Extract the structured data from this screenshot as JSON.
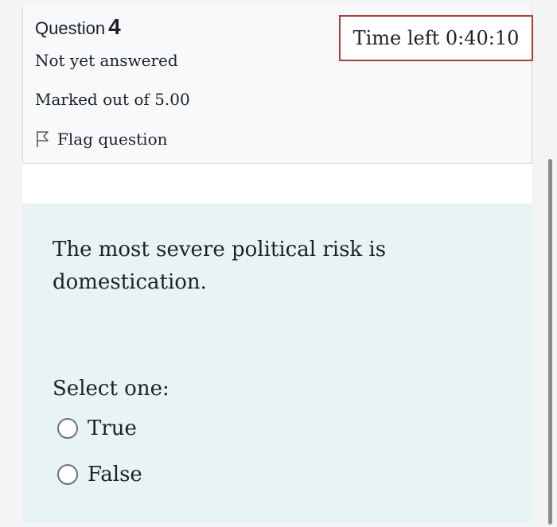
{
  "question_info": {
    "label": "Question",
    "number": "4",
    "status": "Not yet answered",
    "marked_out_of": "Marked out of 5.00",
    "flag_label": "Flag question"
  },
  "timer": {
    "text": "Time left 0:40:10"
  },
  "question": {
    "text": "The most severe political risk is domestication.",
    "prompt": "Select one:",
    "options": [
      {
        "label": "True"
      },
      {
        "label": "False"
      }
    ]
  },
  "icons": {
    "flag": "flag-icon",
    "radio": "radio-unchecked-icon"
  },
  "colors": {
    "timer_border": "#b23a3a",
    "question_bg": "#e7f3f5",
    "info_bg": "#f8f9fa"
  }
}
